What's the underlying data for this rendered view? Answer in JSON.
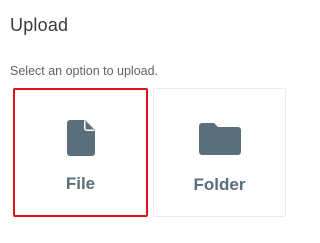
{
  "dialog": {
    "title": "Upload",
    "subtitle": "Select an option to upload."
  },
  "options": [
    {
      "label": "File",
      "icon": "file-icon",
      "selected": true
    },
    {
      "label": "Folder",
      "icon": "folder-icon",
      "selected": false
    }
  ],
  "colors": {
    "icon": "#5a6e7c",
    "selected_border": "#e0121b",
    "title": "#3b3b3b",
    "subtitle": "#5f6368"
  }
}
